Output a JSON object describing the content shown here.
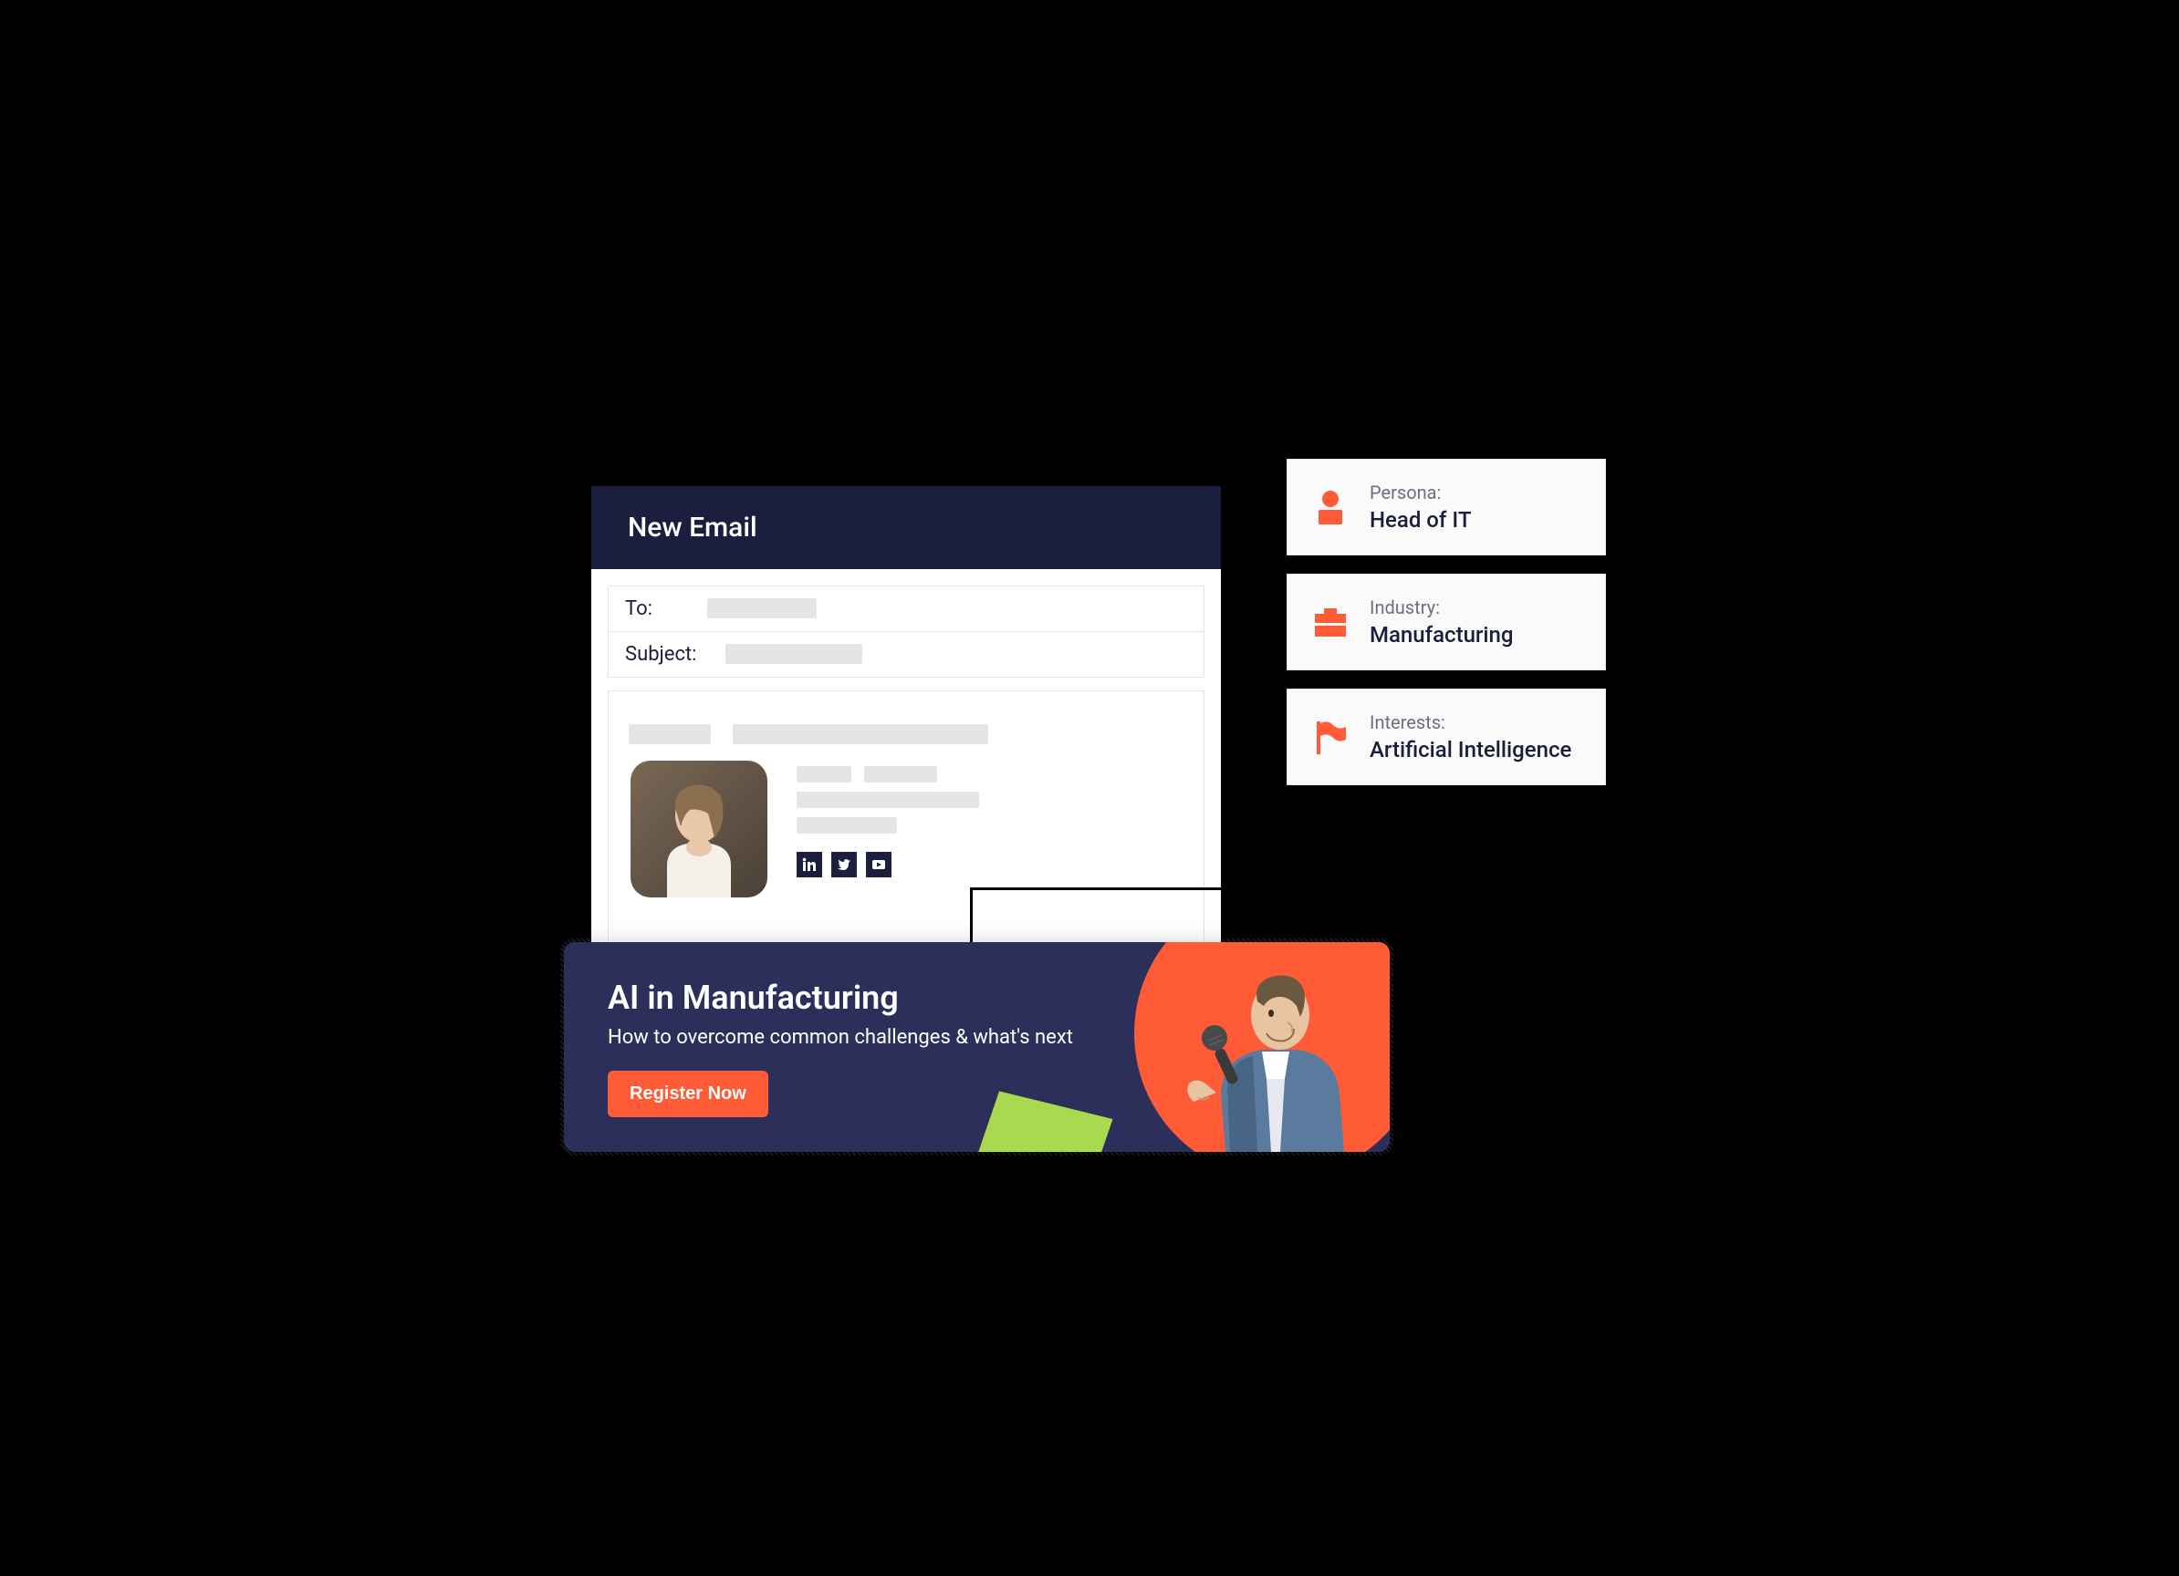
{
  "email": {
    "header": "New Email",
    "to_label": "To:",
    "subject_label": "Subject:"
  },
  "banner": {
    "title": "AI in Manufacturing",
    "subtitle": "How to overcome common challenges & what's next",
    "cta": "Register Now"
  },
  "attributes": [
    {
      "label": "Persona:",
      "value": "Head of IT",
      "icon": "person"
    },
    {
      "label": "Industry:",
      "value": "Manufacturing",
      "icon": "briefcase"
    },
    {
      "label": "Interests:",
      "value": "Artificial Intelligence",
      "icon": "flag"
    }
  ],
  "social": {
    "linkedin": "linkedin-icon",
    "twitter": "twitter-icon",
    "youtube": "youtube-icon"
  }
}
